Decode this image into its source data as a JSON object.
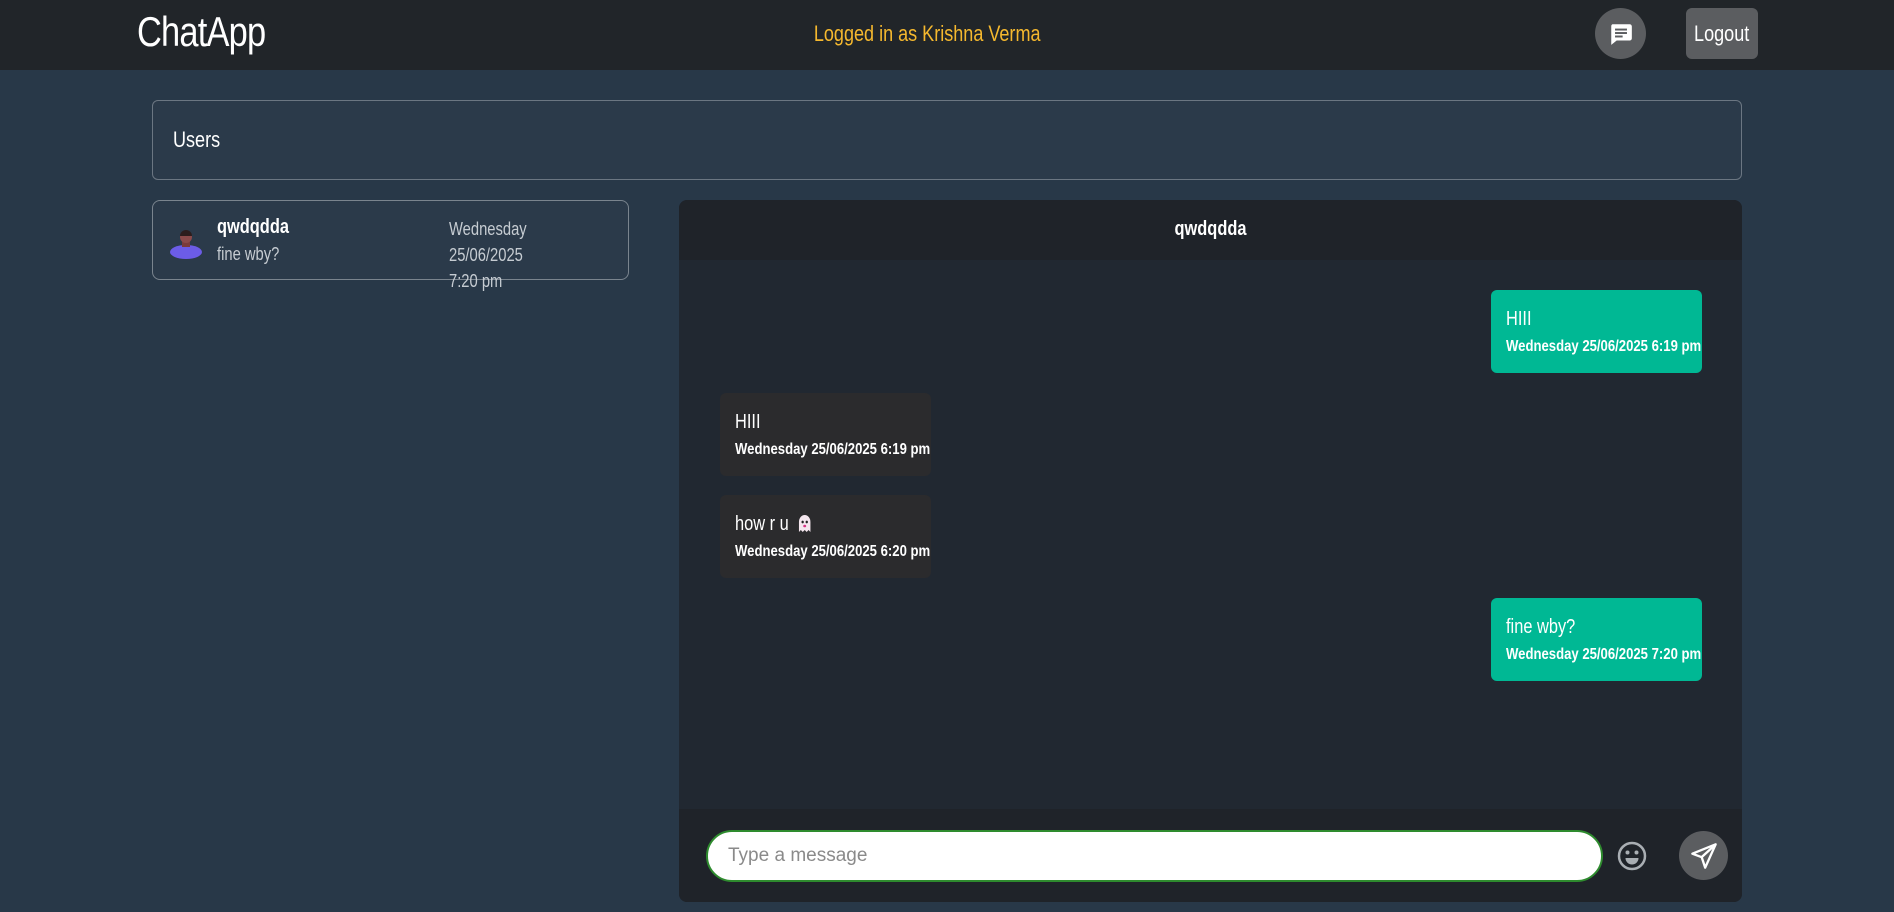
{
  "header": {
    "brand": "ChatApp",
    "logged_in_text": "Logged in as Krishna Verma",
    "logout_label": "Logout",
    "accent_color": "#f5b82e"
  },
  "users_panel": {
    "title": "Users",
    "items": [
      {
        "name": "qwdqdda",
        "last_message": "fine wby?",
        "timestamp_line1": "Wednesday 25/06/2025",
        "timestamp_line2": "7:20 pm"
      }
    ]
  },
  "chat": {
    "contact_name": "qwdqdda",
    "messages": [
      {
        "direction": "sent",
        "text": "HIII",
        "time": "Wednesday 25/06/2025 6:19 pm"
      },
      {
        "direction": "received",
        "text": "HIII",
        "time": "Wednesday 25/06/2025 6:19 pm"
      },
      {
        "direction": "received",
        "text": "how r u",
        "emoji": "ghost-icon",
        "time": "Wednesday 25/06/2025 6:20 pm"
      },
      {
        "direction": "sent",
        "text": "fine wby?",
        "time": "Wednesday 25/06/2025 7:20 pm"
      }
    ],
    "sent_color": "#00b894",
    "received_color": "#2b2b2d"
  },
  "composer": {
    "placeholder": "Type a message",
    "value": ""
  },
  "icons": {
    "chat_nav": "chat-bubble-icon",
    "emoji": "smiley-icon",
    "send": "paper-plane-icon",
    "avatar": "user-avatar-icon"
  }
}
